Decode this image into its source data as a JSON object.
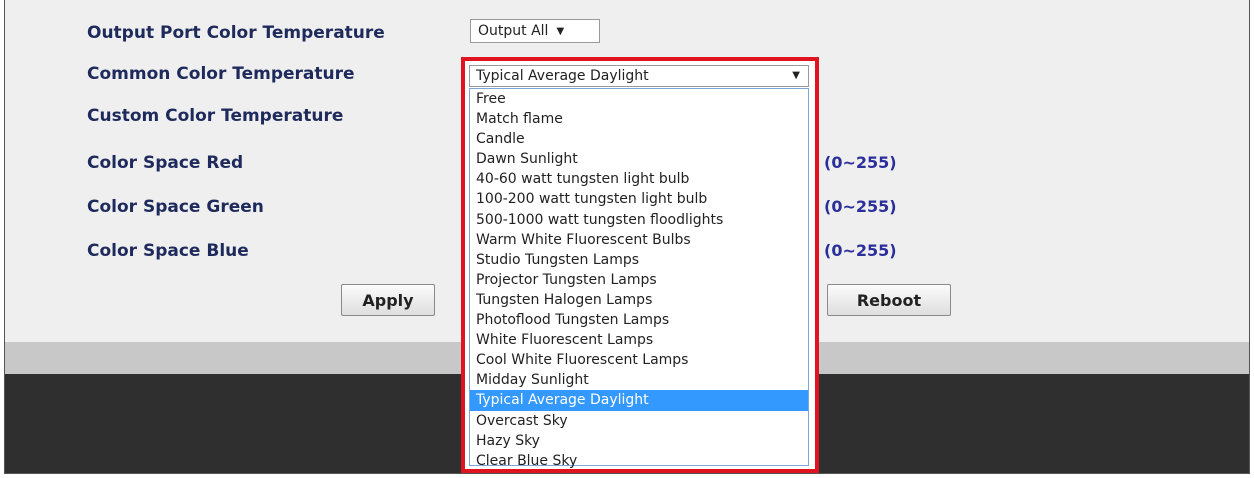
{
  "form": {
    "labels": {
      "output_port": "Output Port Color Temperature",
      "common": "Common Color Temperature",
      "custom": "Custom Color Temperature",
      "red": "Color Space Red",
      "green": "Color Space Green",
      "blue": "Color Space Blue"
    },
    "output_port_select": "Output All",
    "common_select": "Typical Average Daylight",
    "range_red": "(0~255)",
    "range_green": "(0~255)",
    "range_blue": "(0~255)",
    "apply_label": "Apply",
    "reboot_label": "Reboot"
  },
  "dropdown": {
    "selected_index": 15,
    "options": [
      "Free",
      "Match flame",
      "Candle",
      "Dawn Sunlight",
      "40-60 watt tungsten light bulb",
      "100-200 watt tungsten light bulb",
      "500-1000 watt tungsten floodlights",
      "Warm White Fluorescent Bulbs",
      "Studio Tungsten Lamps",
      "Projector Tungsten Lamps",
      "Tungsten Halogen Lamps",
      "Photoflood Tungsten Lamps",
      "White Fluorescent Lamps",
      "Cool White Fluorescent Lamps",
      "Midday Sunlight",
      "Typical Average Daylight",
      "Overcast Sky",
      "Hazy Sky",
      "Clear Blue Sky"
    ]
  },
  "colors": {
    "highlight": "#e0141e",
    "selected_option": "#3399ff",
    "label": "#1f2a5c",
    "range": "#2a2f9a"
  }
}
